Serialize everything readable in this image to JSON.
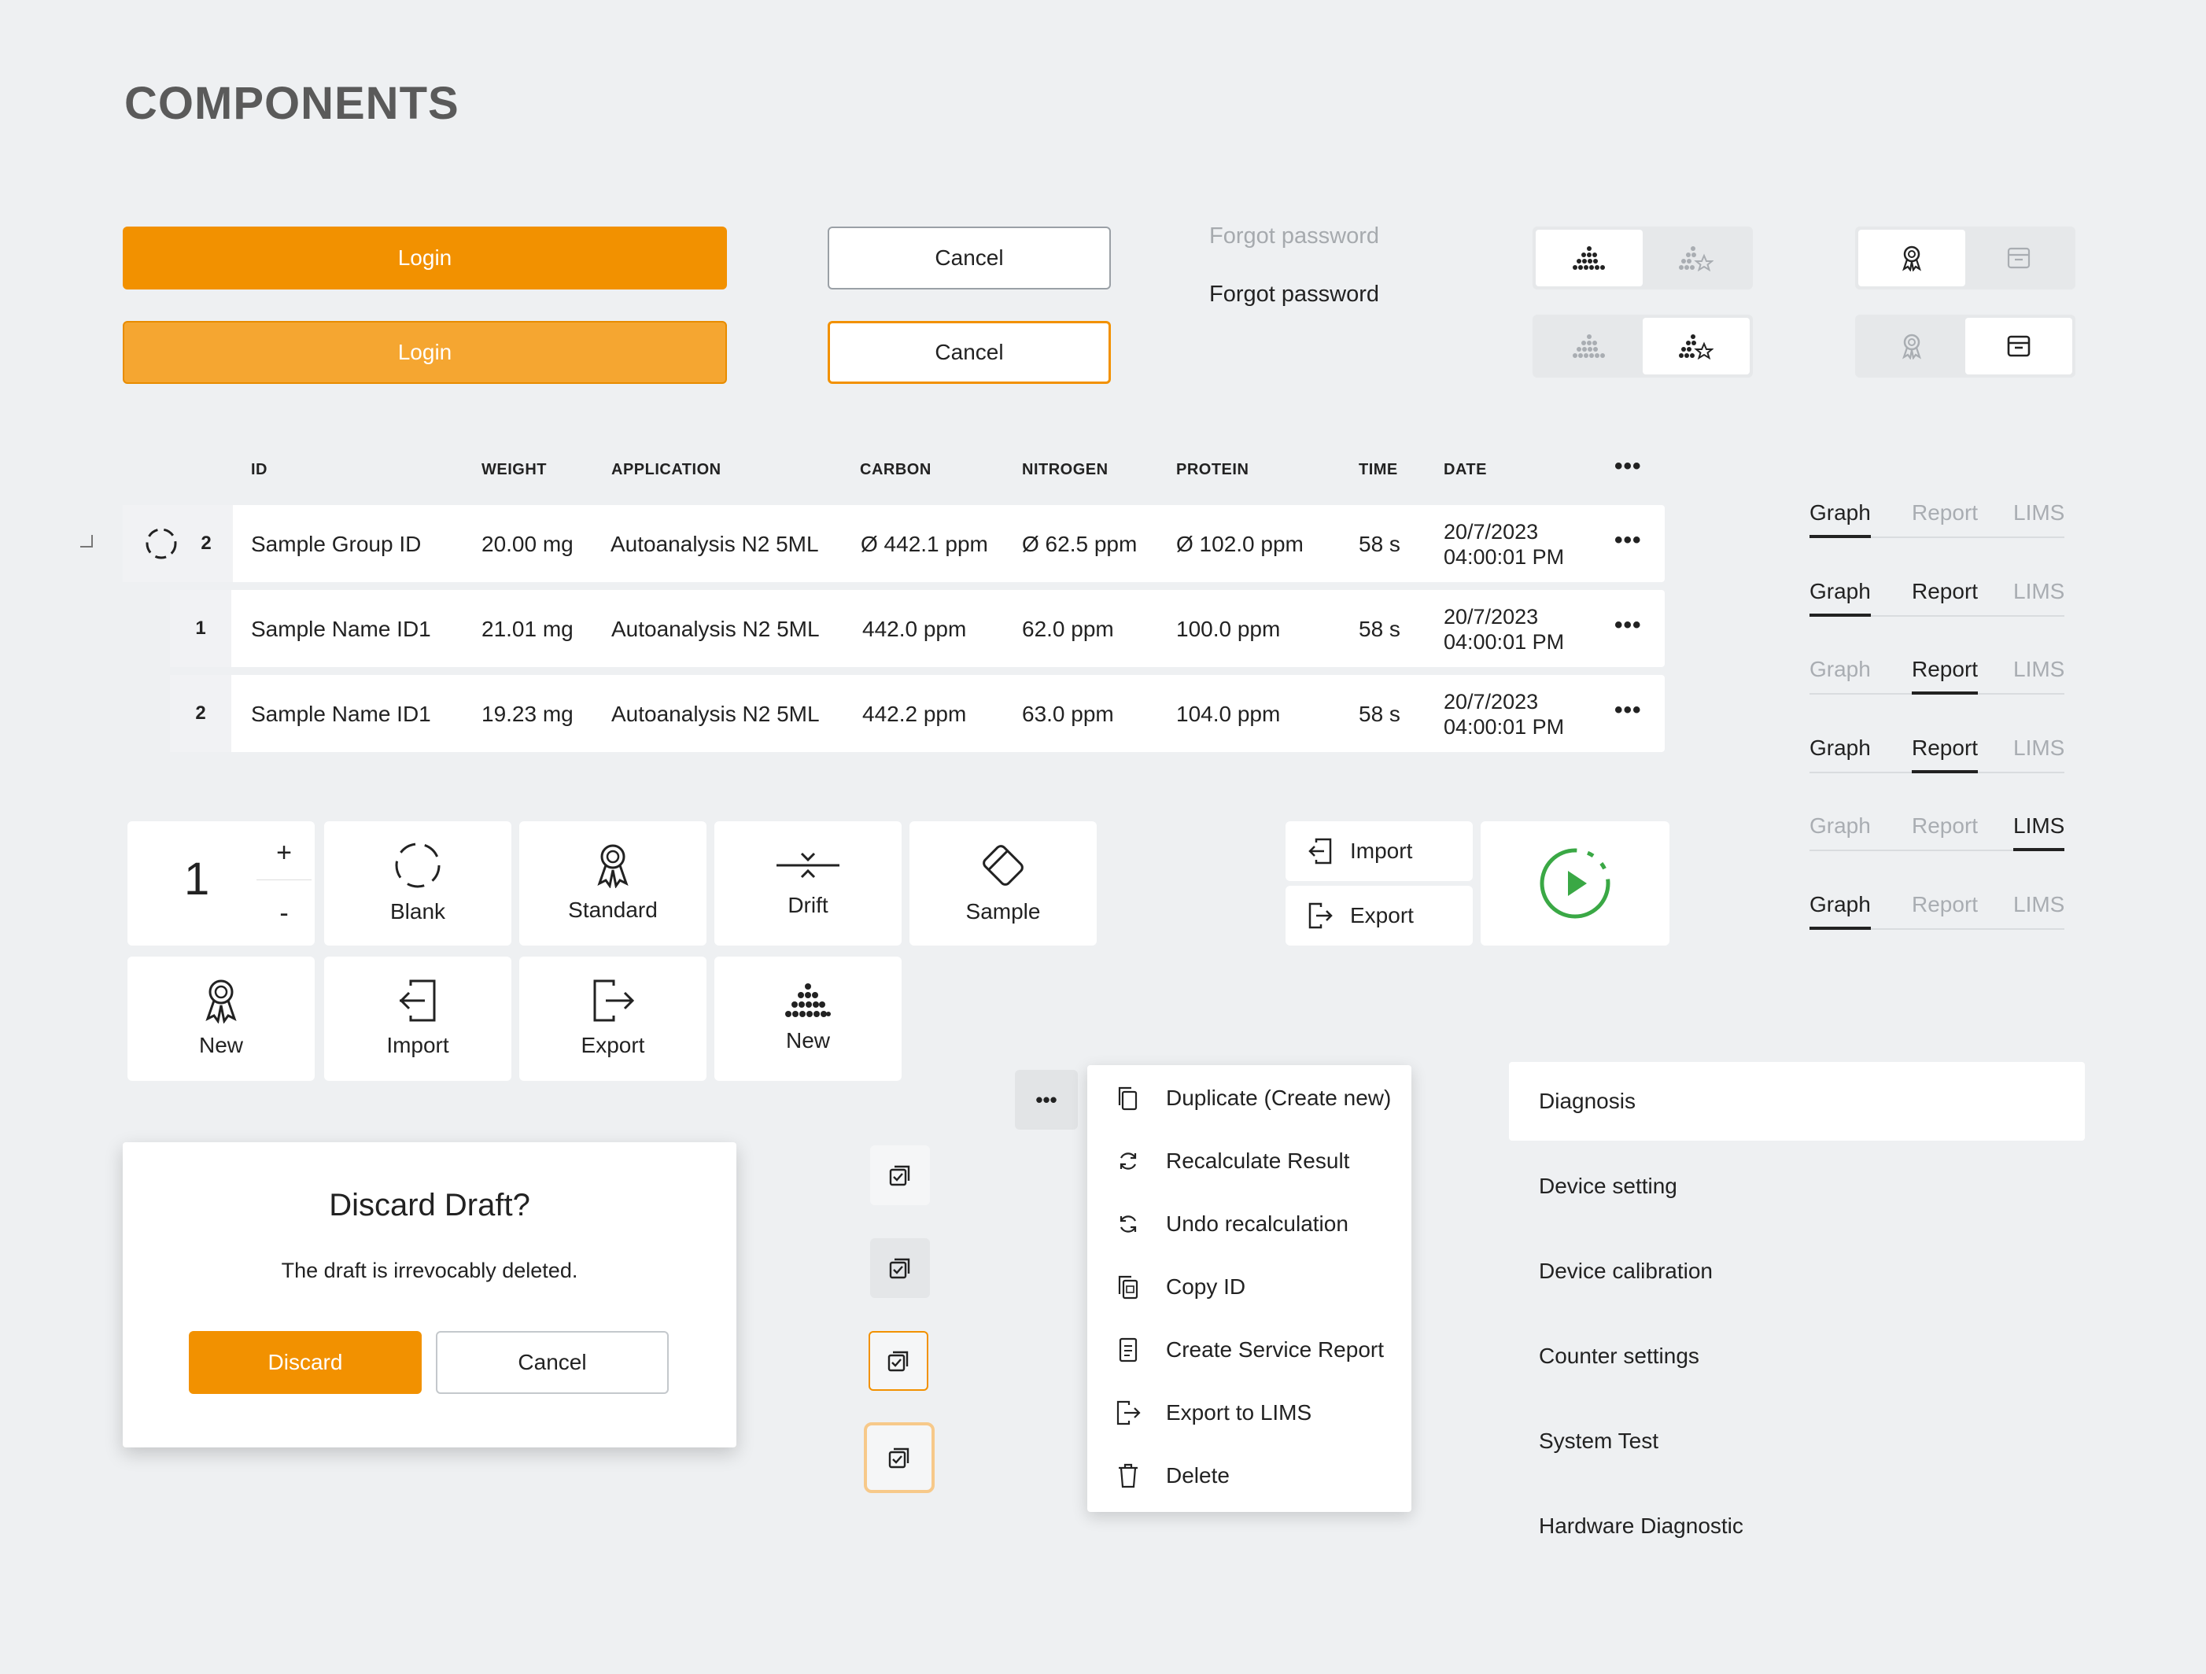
{
  "page_title": "COMPONENTS",
  "buttons": {
    "login_default": "Login",
    "login_hover": "Login",
    "cancel_default": "Cancel",
    "cancel_focus": "Cancel"
  },
  "links": {
    "forgot_muted": "Forgot password",
    "forgot_active": "Forgot password"
  },
  "table": {
    "headers": [
      "ID",
      "WEIGHT",
      "APPLICATION",
      "CARBON",
      "NITROGEN",
      "PROTEIN",
      "TIME",
      "DATE"
    ],
    "more_label": "•••",
    "rows": [
      {
        "id": "2",
        "name": "Sample Group ID",
        "weight": "20.00 mg",
        "application": "Autoanalysis N2 5ML",
        "carbon": "Ø 442.1 ppm",
        "nitrogen": "Ø 62.5 ppm",
        "protein": "Ø 102.0 ppm",
        "time": "58 s",
        "date": "20/7/2023",
        "clock": "04:00:01 PM"
      },
      {
        "id": "1",
        "name": "Sample Name ID1",
        "weight": "21.01 mg",
        "application": "Autoanalysis N2 5ML",
        "carbon": "442.0 ppm",
        "nitrogen": "62.0 ppm",
        "protein": "100.0 ppm",
        "time": "58 s",
        "date": "20/7/2023",
        "clock": "04:00:01 PM"
      },
      {
        "id": "2",
        "name": "Sample Name ID1",
        "weight": "19.23 mg",
        "application": "Autoanalysis N2 5ML",
        "carbon": "442.2 ppm",
        "nitrogen": "63.0 ppm",
        "protein": "104.0 ppm",
        "time": "58 s",
        "date": "20/7/2023",
        "clock": "04:00:01 PM"
      }
    ]
  },
  "tabs": {
    "labels": [
      "Graph",
      "Report",
      "LIMS"
    ]
  },
  "tiles": {
    "counter_value": "1",
    "plus": "+",
    "minus": "-",
    "blank": "Blank",
    "standard": "Standard",
    "drift": "Drift",
    "sample": "Sample",
    "new_standard": "New",
    "import": "Import",
    "export": "Export",
    "new_sample": "New"
  },
  "side_actions": {
    "import": "Import",
    "export": "Export"
  },
  "dialog": {
    "title": "Discard Draft?",
    "message": "The draft is irrevocably deleted.",
    "confirm": "Discard",
    "cancel": "Cancel"
  },
  "menu": {
    "trigger": "•••",
    "items": [
      "Duplicate (Create new)",
      "Recalculate Result",
      "Undo recalculation",
      "Copy ID",
      "Create Service Report",
      "Export to LIMS",
      "Delete"
    ]
  },
  "nav": {
    "items": [
      "Diagnosis",
      "Device setting",
      "Device calibration",
      "Counter settings",
      "System Test",
      "Hardware Diagnostic"
    ]
  },
  "colors": {
    "accent": "#f29100",
    "accent_hover": "#f5a631",
    "play_green": "#3aa845",
    "background": "#eef0f2"
  }
}
